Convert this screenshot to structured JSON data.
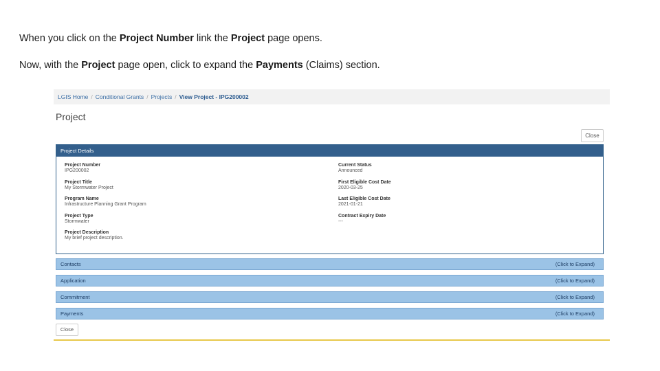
{
  "instructions": {
    "line1": {
      "a": "When you click on the ",
      "b": "Project Number",
      "c": " link the ",
      "d": "Project",
      "e": " page opens."
    },
    "line2": {
      "a": "Now, with the ",
      "b": "Project",
      "c": " page open, click to expand the ",
      "d": "Payments",
      "e": " (Claims) section."
    }
  },
  "breadcrumb": [
    "LGIS Home",
    "Conditional Grants",
    "Projects",
    "View Project - IPG200002"
  ],
  "page_title": "Project",
  "close_label": "Close",
  "details": {
    "header": "Project Details",
    "left": [
      {
        "label": "Project Number",
        "value": "IPG200002"
      },
      {
        "label": "Project Title",
        "value": "My Stormwater Project"
      },
      {
        "label": "Program Name",
        "value": "Infrastructure Planning Grant Program"
      },
      {
        "label": "Project Type",
        "value": "Stormwater"
      },
      {
        "label": "Project Description",
        "value": "My brief project description."
      }
    ],
    "right": [
      {
        "label": "Current Status",
        "value": "Announced"
      },
      {
        "label": "First Eligible Cost Date",
        "value": "2020-03-25"
      },
      {
        "label": "Last Eligible Cost Date",
        "value": "2021-01-21"
      },
      {
        "label": "Contract Expiry Date",
        "value": "---"
      }
    ]
  },
  "sections": [
    {
      "title": "Contacts",
      "hint": "(Click to Expand)"
    },
    {
      "title": "Application",
      "hint": "(Click to Expand)"
    },
    {
      "title": "Commitment",
      "hint": "(Click to Expand)"
    },
    {
      "title": "Payments",
      "hint": "(Click to Expand)"
    }
  ],
  "colors": {
    "panel_header": "#335f8c",
    "section_bar": "#9bc3e6",
    "accent_rule": "#e8c84a"
  }
}
